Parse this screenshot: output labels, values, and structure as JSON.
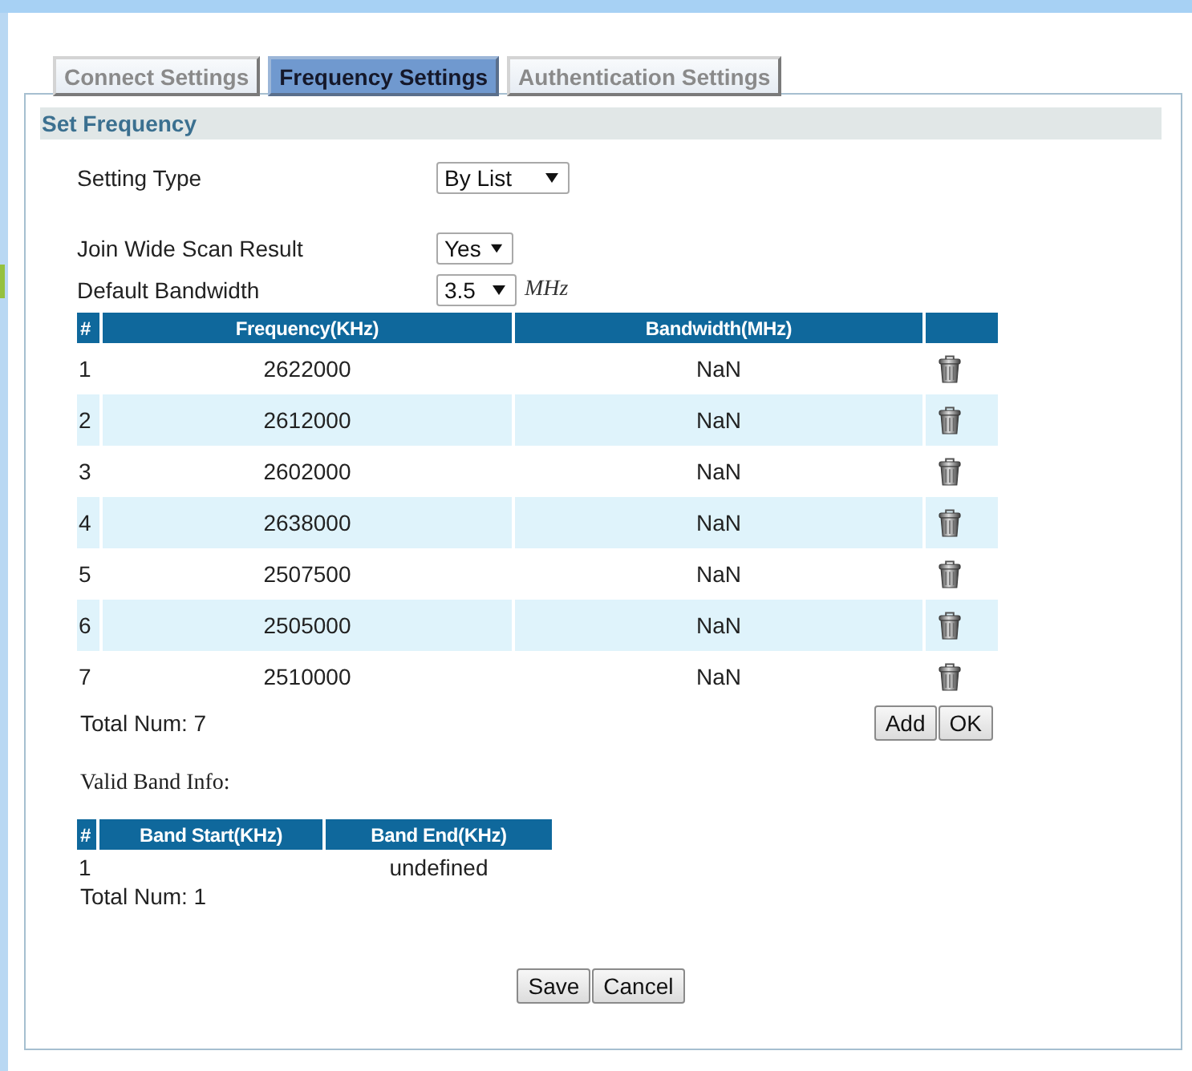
{
  "tabs": [
    {
      "label": "Connect Settings",
      "selected": false
    },
    {
      "label": "Frequency Settings",
      "selected": true
    },
    {
      "label": "Authentication Settings",
      "selected": false
    }
  ],
  "section": {
    "title": "Set Frequency",
    "fields": [
      {
        "label": "Setting Type",
        "value": "By List"
      },
      {
        "label": "Join Wide Scan Result",
        "value": "Yes"
      },
      {
        "label": "Default Bandwidth",
        "value": "3.5",
        "unit": "MHz"
      }
    ],
    "frequency_table": {
      "columns": [
        "#",
        "Frequency(KHz)",
        "Bandwidth(MHz)"
      ],
      "rows": [
        {
          "number": "1",
          "frequency": "2622000",
          "bandwidth": "NaN"
        },
        {
          "number": "2",
          "frequency": "2612000",
          "bandwidth": "NaN"
        },
        {
          "number": "3",
          "frequency": "2602000",
          "bandwidth": "NaN"
        },
        {
          "number": "4",
          "frequency": "2638000",
          "bandwidth": "NaN"
        },
        {
          "number": "5",
          "frequency": "2507500",
          "bandwidth": "NaN"
        },
        {
          "number": "6",
          "frequency": "2505000",
          "bandwidth": "NaN"
        },
        {
          "number": "7",
          "frequency": "2510000",
          "bandwidth": "NaN"
        }
      ],
      "total": "Total Num: 7",
      "buttons": [
        "Add",
        "OK"
      ]
    },
    "band_info": {
      "title": "Valid Band Info:",
      "columns": [
        "#",
        "Band Start(KHz)",
        "Band End(KHz)"
      ],
      "rows": [
        {
          "number": "1",
          "band_end": "undefined"
        }
      ],
      "total": "Total Num: 1"
    },
    "buttons": [
      "Save",
      "Cancel"
    ]
  }
}
